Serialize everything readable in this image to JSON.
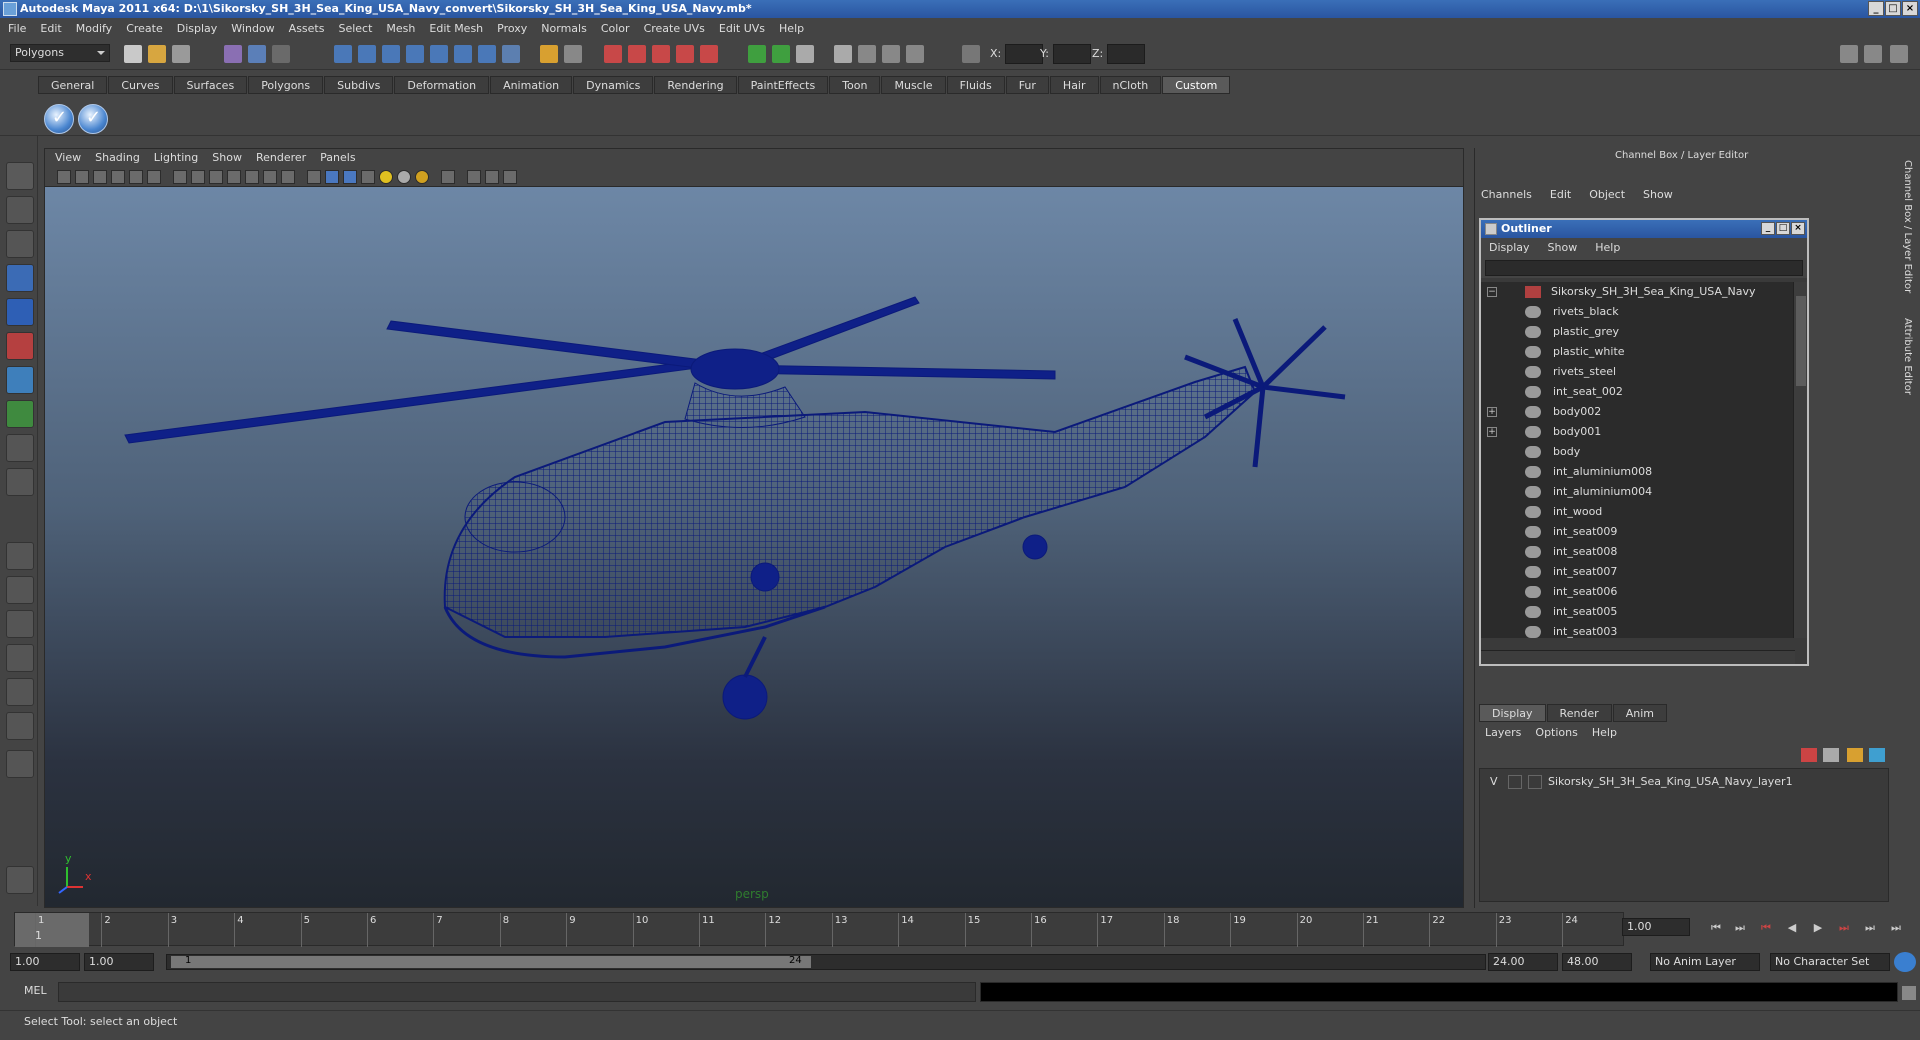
{
  "window": {
    "title": "Autodesk Maya 2011 x64: D:\\1\\Sikorsky_SH_3H_Sea_King_USA_Navy_convert\\Sikorsky_SH_3H_Sea_King_USA_Navy.mb*"
  },
  "menubar": [
    "File",
    "Edit",
    "Modify",
    "Create",
    "Display",
    "Window",
    "Assets",
    "Select",
    "Mesh",
    "Edit Mesh",
    "Proxy",
    "Normals",
    "Color",
    "Create UVs",
    "Edit UVs",
    "Help"
  ],
  "toolbar": {
    "mode": "Polygons",
    "x_label": "X:",
    "y_label": "Y:",
    "z_label": "Z:"
  },
  "shelf": {
    "tabs": [
      "General",
      "Curves",
      "Surfaces",
      "Polygons",
      "Subdivs",
      "Deformation",
      "Animation",
      "Dynamics",
      "Rendering",
      "PaintEffects",
      "Toon",
      "Muscle",
      "Fluids",
      "Fur",
      "Hair",
      "nCloth",
      "Custom"
    ],
    "active": "Custom"
  },
  "viewport": {
    "menu": [
      "View",
      "Shading",
      "Lighting",
      "Show",
      "Renderer",
      "Panels"
    ],
    "camera": "persp",
    "axis_y": "y",
    "axis_x": "x"
  },
  "channelbox": {
    "title": "Channel Box / Layer Editor",
    "menu": [
      "Channels",
      "Edit",
      "Object",
      "Show"
    ]
  },
  "outliner": {
    "title": "Outliner",
    "menu": [
      "Display",
      "Show",
      "Help"
    ],
    "root": "Sikorsky_SH_3H_Sea_King_USA_Navy",
    "items": [
      "rivets_black",
      "plastic_grey",
      "plastic_white",
      "rivets_steel",
      "int_seat_002",
      "body002",
      "body001",
      "body",
      "int_aluminium008",
      "int_aluminium004",
      "int_wood",
      "int_seat009",
      "int_seat008",
      "int_seat007",
      "int_seat006",
      "int_seat005",
      "int_seat003"
    ],
    "expandable": [
      "body002",
      "body001"
    ]
  },
  "layers": {
    "tabs": [
      "Display",
      "Render",
      "Anim"
    ],
    "active": "Display",
    "menu": [
      "Layers",
      "Options",
      "Help"
    ],
    "rows": [
      {
        "v": "V",
        "name": "Sikorsky_SH_3H_Sea_King_USA_Navy_layer1"
      }
    ]
  },
  "sidetabs": {
    "channel": "Channel Box / Layer Editor",
    "attr": "Attribute Editor"
  },
  "timeline": {
    "frames": [
      "1",
      "2",
      "3",
      "4",
      "5",
      "6",
      "7",
      "8",
      "9",
      "10",
      "11",
      "12",
      "13",
      "14",
      "15",
      "16",
      "17",
      "18",
      "19",
      "20",
      "21",
      "22",
      "23",
      "24"
    ],
    "current_frame": "1",
    "current_field": "1.00"
  },
  "range": {
    "start": "1.00",
    "start2": "1.00",
    "slider_a": "1",
    "slider_b": "24",
    "end": "24.00",
    "end2": "48.00",
    "anim_layer": "No Anim Layer",
    "char_set": "No Character Set"
  },
  "cmd": {
    "label": "MEL"
  },
  "status": {
    "text": "Select Tool: select an object"
  },
  "colors": {
    "wireframe": "#0b1a7a",
    "titlebar": "#2a55a0"
  }
}
